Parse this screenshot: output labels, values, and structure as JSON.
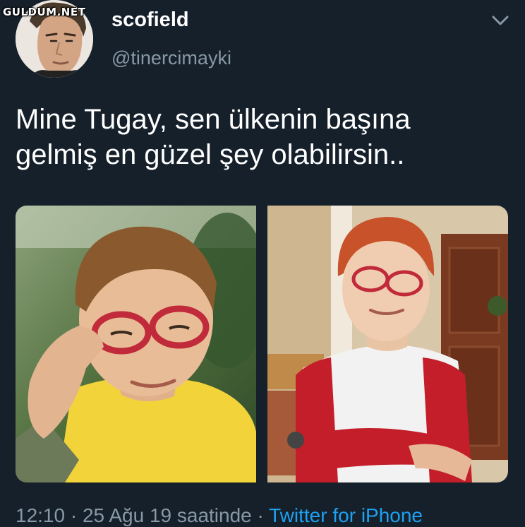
{
  "watermark": "GULDUM.NET",
  "tweet": {
    "display_name": "scofield",
    "handle": "@tinercimayki",
    "text_lines": [
      "Mine Tugay, sen ülkenin başına",
      "gelmiş en güzel şey olabilirsin.."
    ],
    "time": "12:10",
    "separator": "·",
    "date_suffix": "25 Ağu 19 saatinde",
    "client": "Twitter for iPhone"
  },
  "icons": {
    "menu": "chevron-down-icon",
    "avatar": "avatar-photo"
  },
  "colors": {
    "background": "#15202b",
    "secondary_text": "#8899a6",
    "link": "#1da1f2"
  }
}
